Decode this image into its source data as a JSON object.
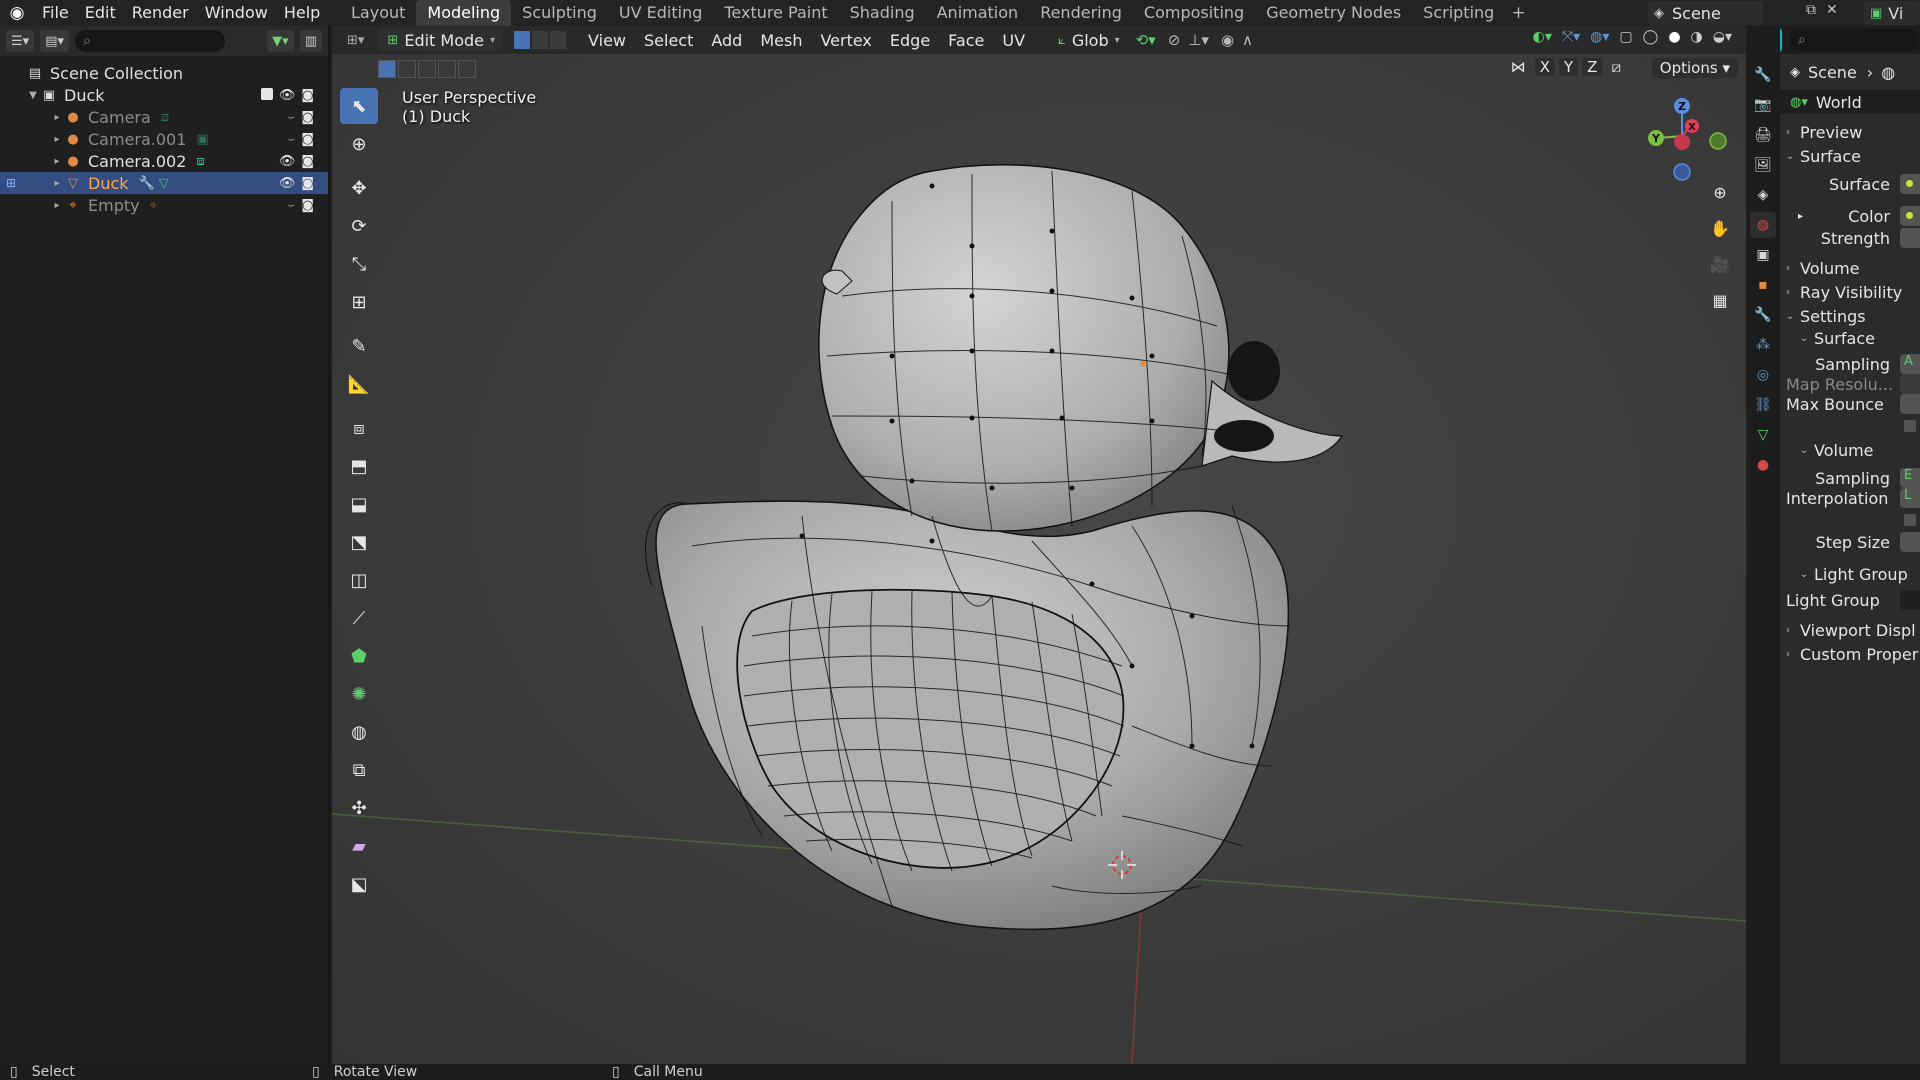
{
  "topbar": {
    "menus": [
      "File",
      "Edit",
      "Render",
      "Window",
      "Help"
    ],
    "workspaces": [
      "Layout",
      "Modeling",
      "Sculpting",
      "UV Editing",
      "Texture Paint",
      "Shading",
      "Animation",
      "Rendering",
      "Compositing",
      "Geometry Nodes",
      "Scripting"
    ],
    "active_workspace": "Modeling",
    "add_workspace": "+",
    "scene_name": "Scene",
    "view_layer": "Vi"
  },
  "outliner": {
    "search_placeholder": "",
    "rows": [
      {
        "label": "Scene Collection",
        "icon": "scene-collection-icon",
        "depth": 0
      },
      {
        "label": "Duck",
        "icon": "collection-icon",
        "depth": 1
      },
      {
        "label": "Camera",
        "icon": "camera-icon",
        "depth": 2
      },
      {
        "label": "Camera.001",
        "icon": "camera-icon",
        "depth": 2
      },
      {
        "label": "Camera.002",
        "icon": "camera-icon",
        "depth": 2
      },
      {
        "label": "Duck",
        "icon": "mesh-icon",
        "depth": 2
      },
      {
        "label": "Empty",
        "icon": "empty-icon",
        "depth": 2
      }
    ]
  },
  "viewport": {
    "mode": "Edit Mode",
    "menus": [
      "View",
      "Select",
      "Add",
      "Mesh",
      "Vertex",
      "Edge",
      "Face",
      "UV"
    ],
    "orientation": "Glob",
    "info_line1": "User Perspective",
    "info_line2": "(1) Duck",
    "axis_x": "X",
    "axis_y": "Y",
    "axis_z": "Z",
    "options": "Options",
    "gizmo_x": "X",
    "gizmo_y": "Y",
    "gizmo_z": "Z"
  },
  "properties": {
    "context_scene": "Scene",
    "world_name": "World",
    "preview": "Preview",
    "surface": "Surface",
    "surface_field": "Surface",
    "color": "Color",
    "strength": "Strength",
    "volume": "Volume",
    "ray_visibility": "Ray Visibility",
    "settings": "Settings",
    "settings_surface": "Surface",
    "sampling": "Sampling",
    "sampling_value": "A",
    "map_resolution": "Map Resolu...",
    "max_bounce": "Max Bounce",
    "settings_volume": "Volume",
    "vol_sampling": "Sampling",
    "vol_sampling_value": "E",
    "interpolation": "Interpolation",
    "interpolation_value": "L",
    "step_size": "Step Size",
    "light_group_panel": "Light Group",
    "light_group": "Light Group",
    "viewport_display": "Viewport Displ",
    "custom_properties": "Custom Proper"
  },
  "statusbar": {
    "select": "Select",
    "rotate": "Rotate View",
    "call_menu": "Call Menu"
  },
  "colors": {
    "accent_blue": "#4772b3",
    "selected_row": "#334d80",
    "header_cyan": "#00bfbf",
    "vertex_green": "#c8e63c"
  }
}
